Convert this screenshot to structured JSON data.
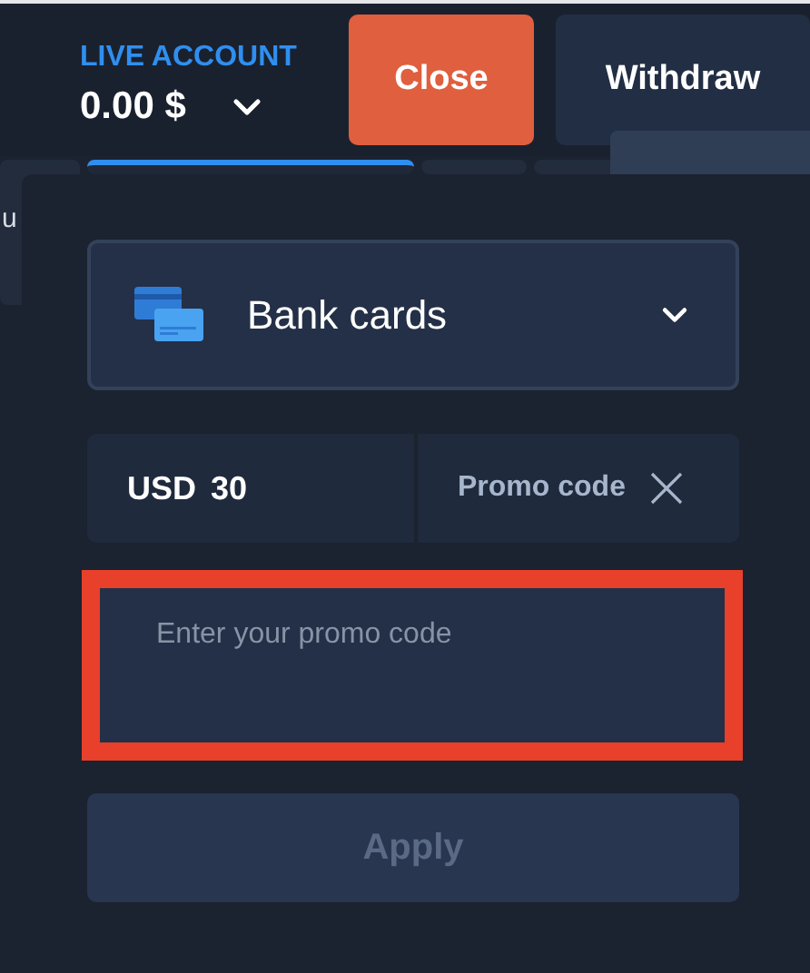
{
  "account": {
    "label": "LIVE ACCOUNT",
    "balance": "0.00 $"
  },
  "header_buttons": [
    {
      "kind": "danger",
      "label": "Close"
    },
    {
      "kind": "secondary",
      "label": "Withdraw"
    }
  ],
  "background_tabs": [
    {
      "label": "u",
      "selected": false
    },
    {
      "selected": true
    },
    {
      "selected": false
    },
    {
      "selected": false
    }
  ],
  "payment_method": {
    "label": "Bank cards"
  },
  "amount": {
    "currency": "USD",
    "value": "30"
  },
  "promo": {
    "label": "Promo code",
    "placeholder": "Enter your promo code",
    "highlighted": true
  },
  "apply_button": {
    "label": "Apply",
    "disabled": true
  }
}
